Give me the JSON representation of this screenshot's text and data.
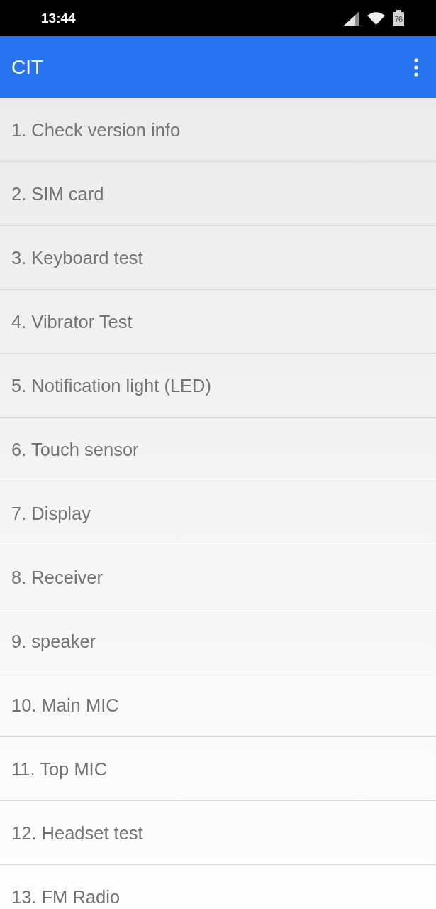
{
  "status_bar": {
    "time": "13:44",
    "battery_text": "76"
  },
  "app_bar": {
    "title": "CIT"
  },
  "items": [
    {
      "label": "1. Check version info"
    },
    {
      "label": "2. SIM card"
    },
    {
      "label": "3. Keyboard test"
    },
    {
      "label": "4. Vibrator Test"
    },
    {
      "label": "5. Notification light (LED)"
    },
    {
      "label": "6. Touch sensor"
    },
    {
      "label": "7. Display"
    },
    {
      "label": "8. Receiver"
    },
    {
      "label": "9. speaker"
    },
    {
      "label": "10. Main MIC"
    },
    {
      "label": "11. Top MIC"
    },
    {
      "label": "12. Headset test"
    },
    {
      "label": "13. FM Radio"
    }
  ]
}
